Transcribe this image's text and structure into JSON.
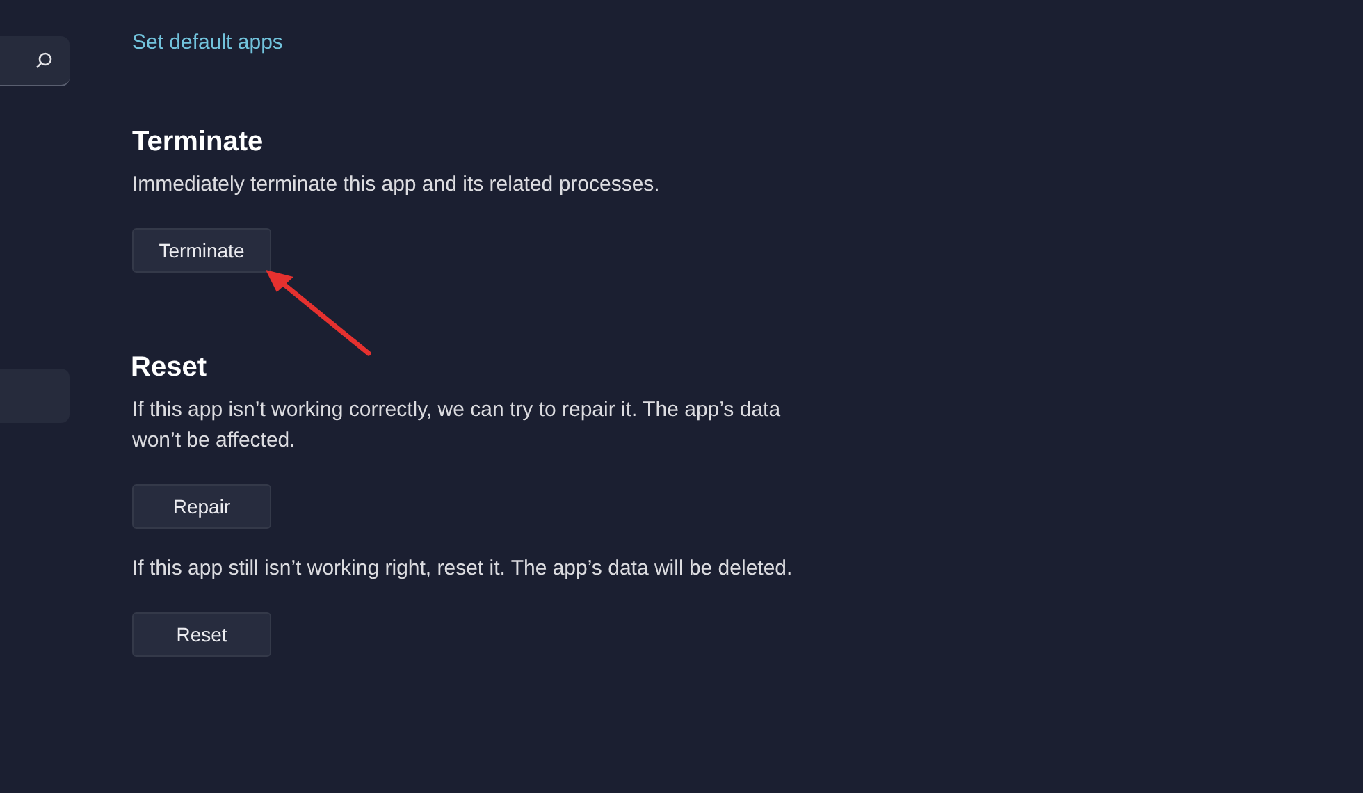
{
  "sidebar": {
    "items": [
      {
        "selected": true
      }
    ]
  },
  "link": "Set default apps",
  "sections": [
    {
      "title": "Terminate",
      "blocks": [
        {
          "description": "Immediately terminate this app and its related processes.",
          "button": "Terminate"
        }
      ]
    },
    {
      "title": "Reset",
      "blocks": [
        {
          "description": "If this app isn’t working correctly, we can try to repair it. The app’s data won’t be affected.",
          "button": "Repair"
        },
        {
          "description": "If this app still isn’t working right, reset it. The app’s data will be deleted.",
          "button": "Reset"
        }
      ]
    }
  ]
}
